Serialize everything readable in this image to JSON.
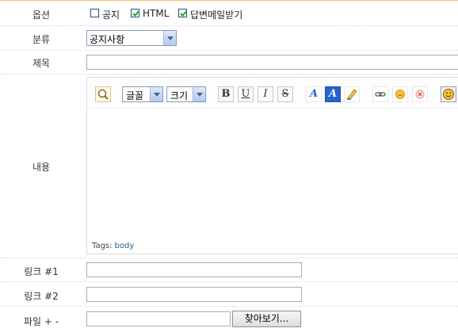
{
  "options": {
    "label": "옵션",
    "checkboxes": [
      {
        "label": "공지",
        "checked": false
      },
      {
        "label": "HTML",
        "checked": true
      },
      {
        "label": "답변메일받기",
        "checked": true
      }
    ]
  },
  "category": {
    "label": "분류",
    "selected": "공지사항"
  },
  "title": {
    "label": "제목",
    "value": ""
  },
  "content": {
    "label": "내용",
    "toolbar": {
      "font_select": "글꼴",
      "size_select": "크기",
      "bold": "B",
      "underline": "U",
      "italic": "I",
      "strike": "S",
      "font_color": "A",
      "bg_color": "A"
    },
    "tags_label": "Tags:",
    "tags_value": "body"
  },
  "link1": {
    "label": "링크 #1",
    "value": ""
  },
  "link2": {
    "label": "링크 #2",
    "value": ""
  },
  "file": {
    "label": "파일 + -",
    "value": "",
    "browse_label": "찾아보기..."
  },
  "colors": {
    "accent_line": "#f0c070",
    "input_border": "#7f9db9",
    "checkbox_border": "#1c5180"
  }
}
